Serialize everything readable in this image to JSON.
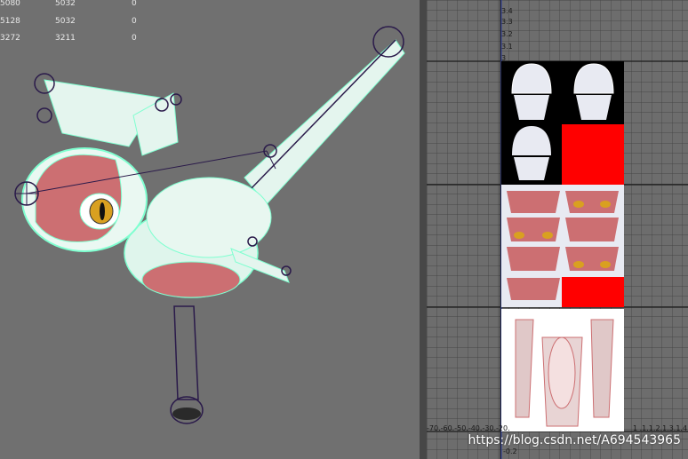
{
  "stats": {
    "rows": [
      {
        "a": "5080",
        "b": "5032",
        "c": "0"
      },
      {
        "a": "5128",
        "b": "5032",
        "c": "0"
      },
      {
        "a": "3272",
        "b": "3211",
        "c": "0"
      }
    ]
  },
  "uv_editor": {
    "v_labels": [
      "3.4",
      "3.3",
      "3.2",
      "3.1",
      "3"
    ],
    "u_labels_left": "-70.-60.-50.-40.-30.-20.",
    "u_labels_right": "1 .1.1.2.1.3.1.4",
    "v_neg_label": "-0.2"
  },
  "watermark": "https://blog.csdn.net/A694543965",
  "colors": {
    "wire": "#7fffd0",
    "skin": "#cc6f72",
    "joint": "#2a1a4a",
    "uv_red": "#ff0000",
    "uv_fill": "#e8eaf2"
  }
}
